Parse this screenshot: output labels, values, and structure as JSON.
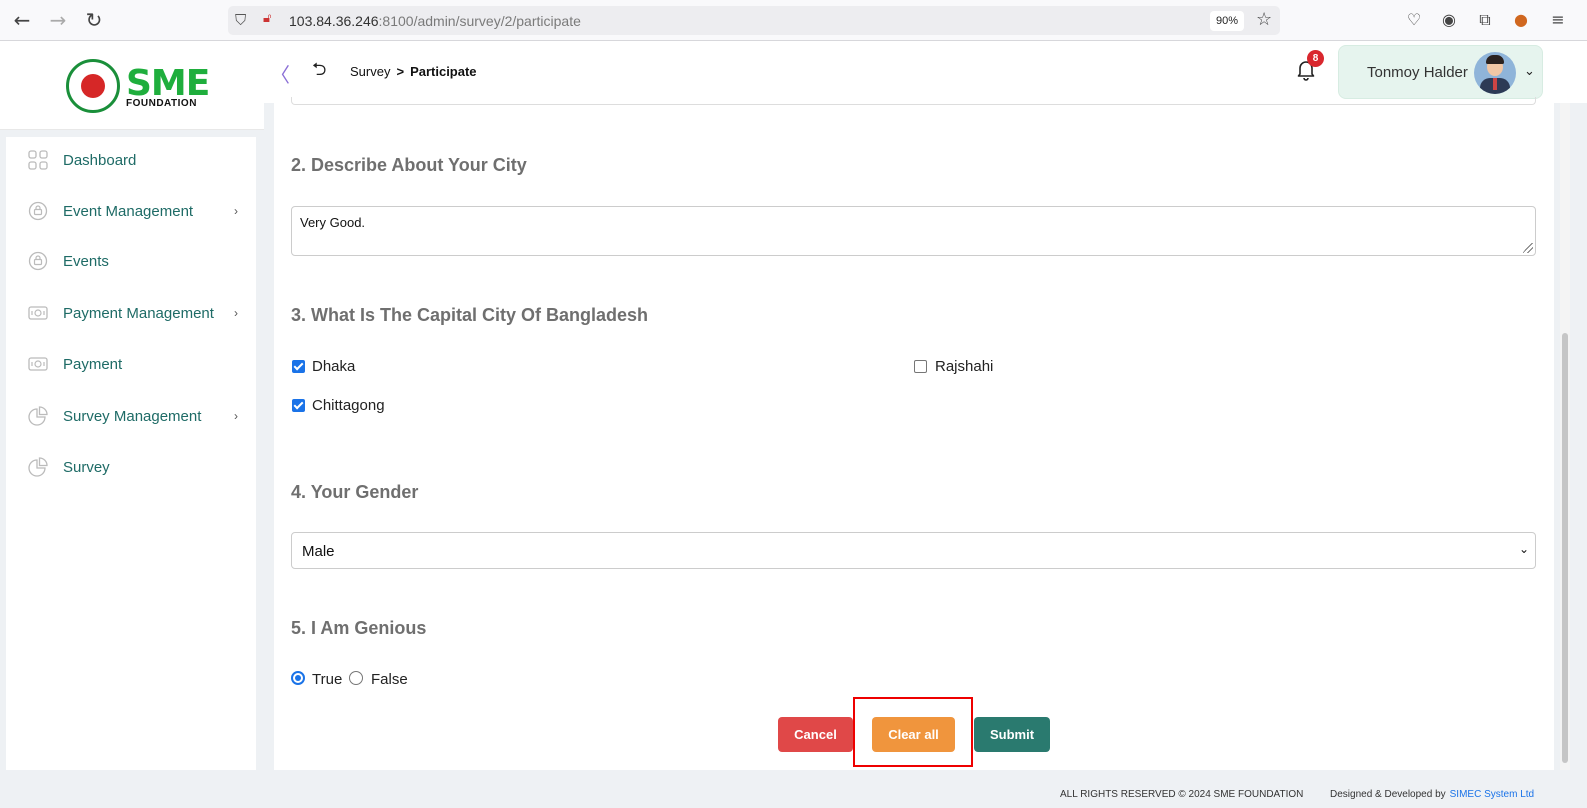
{
  "browser": {
    "url_host": "103.84.36.246",
    "url_rest": ":8100/admin/survey/2/participate",
    "zoom": "90%"
  },
  "brand": {
    "logo_text": "SME",
    "logo_sub": "FOUNDATION"
  },
  "sidebar": {
    "items": [
      {
        "label": "Dashboard",
        "icon": "grid-icon",
        "has_arrow": false
      },
      {
        "label": "Event Management",
        "icon": "event-icon",
        "has_arrow": true,
        "arrow": "›"
      },
      {
        "label": "Events",
        "icon": "event-icon",
        "has_arrow": false
      },
      {
        "label": "Payment Management",
        "icon": "payment-icon",
        "has_arrow": true,
        "arrow": "›"
      },
      {
        "label": "Payment",
        "icon": "payment-icon",
        "has_arrow": false
      },
      {
        "label": "Survey Management",
        "icon": "pie-chart-icon",
        "has_arrow": true,
        "arrow": "›"
      },
      {
        "label": "Survey",
        "icon": "pie-chart-icon",
        "has_arrow": false
      }
    ]
  },
  "header": {
    "breadcrumb_parent": "Survey",
    "breadcrumb_sep": ">",
    "breadcrumb_current": "Participate",
    "notification_count": "8",
    "user_name": "Tonmoy Halder"
  },
  "survey": {
    "q2": {
      "title": "2. Describe About Your City",
      "answer": "Very Good."
    },
    "q3": {
      "title": "3. What Is The Capital City Of Bangladesh",
      "options": [
        {
          "label": "Dhaka",
          "checked": true
        },
        {
          "label": "Rajshahi",
          "checked": false
        },
        {
          "label": "Chittagong",
          "checked": true
        }
      ]
    },
    "q4": {
      "title": "4. Your Gender",
      "selected": "Male"
    },
    "q5": {
      "title": "5. I Am Genious",
      "options": [
        {
          "label": "True",
          "selected": true
        },
        {
          "label": "False",
          "selected": false
        }
      ]
    }
  },
  "actions": {
    "cancel": "Cancel",
    "clear_all": "Clear all",
    "submit": "Submit"
  },
  "footer": {
    "rights": "ALL RIGHTS RESERVED © 2024 SME FOUNDATION",
    "dev_prefix": "Designed & Developed by",
    "dev_name": "SIMEC System Ltd"
  },
  "colors": {
    "brand_green": "#1fae3d",
    "sidebar_text": "#1e6b66",
    "highlight": "#ee0000",
    "cancel": "#e04848",
    "clear": "#f0953d",
    "submit": "#2a7a6f"
  }
}
